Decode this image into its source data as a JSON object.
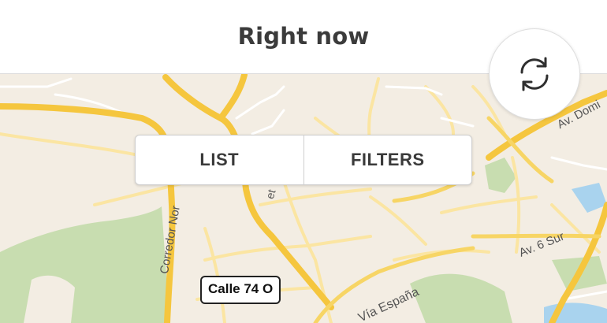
{
  "header": {
    "title": "Right now"
  },
  "toolbar": {
    "refresh_icon": "refresh-icon"
  },
  "view_toggle": {
    "list_label": "LIST",
    "filters_label": "FILTERS"
  },
  "map": {
    "labels": {
      "corredor": "Corredor Nor",
      "av_domi": "Av. Domi",
      "av_6_sur": "Av. 6 Sur",
      "via_espana": "Vía España",
      "et": "et",
      "calle": "Calle 74 O"
    },
    "colors": {
      "land": "#f3ede3",
      "road_major": "#f7cf4a",
      "road_minor": "#fbe7a1",
      "park": "#c9dfb0",
      "water": "#a9d3ee"
    }
  }
}
